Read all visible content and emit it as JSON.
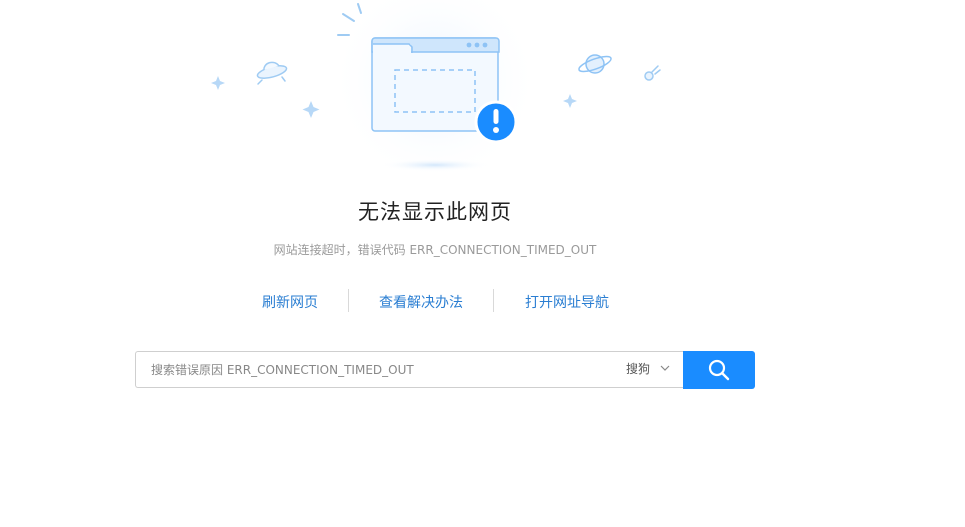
{
  "error": {
    "title": "无法显示此网页",
    "description": "网站连接超时，错误代码 ERR_CONNECTION_TIMED_OUT"
  },
  "actions": {
    "refresh": "刷新网页",
    "solutions": "查看解决办法",
    "open_nav": "打开网址导航"
  },
  "search": {
    "placeholder": "搜索错误原因 ERR_CONNECTION_TIMED_OUT",
    "engine": "搜狗"
  },
  "icons": {
    "alert": "exclamation-icon",
    "search": "search-icon",
    "dropdown": "chevron-down-icon"
  },
  "colors": {
    "accent": "#1a8cff",
    "link": "#2a7ed2",
    "illustration": "#8ec3f5"
  }
}
